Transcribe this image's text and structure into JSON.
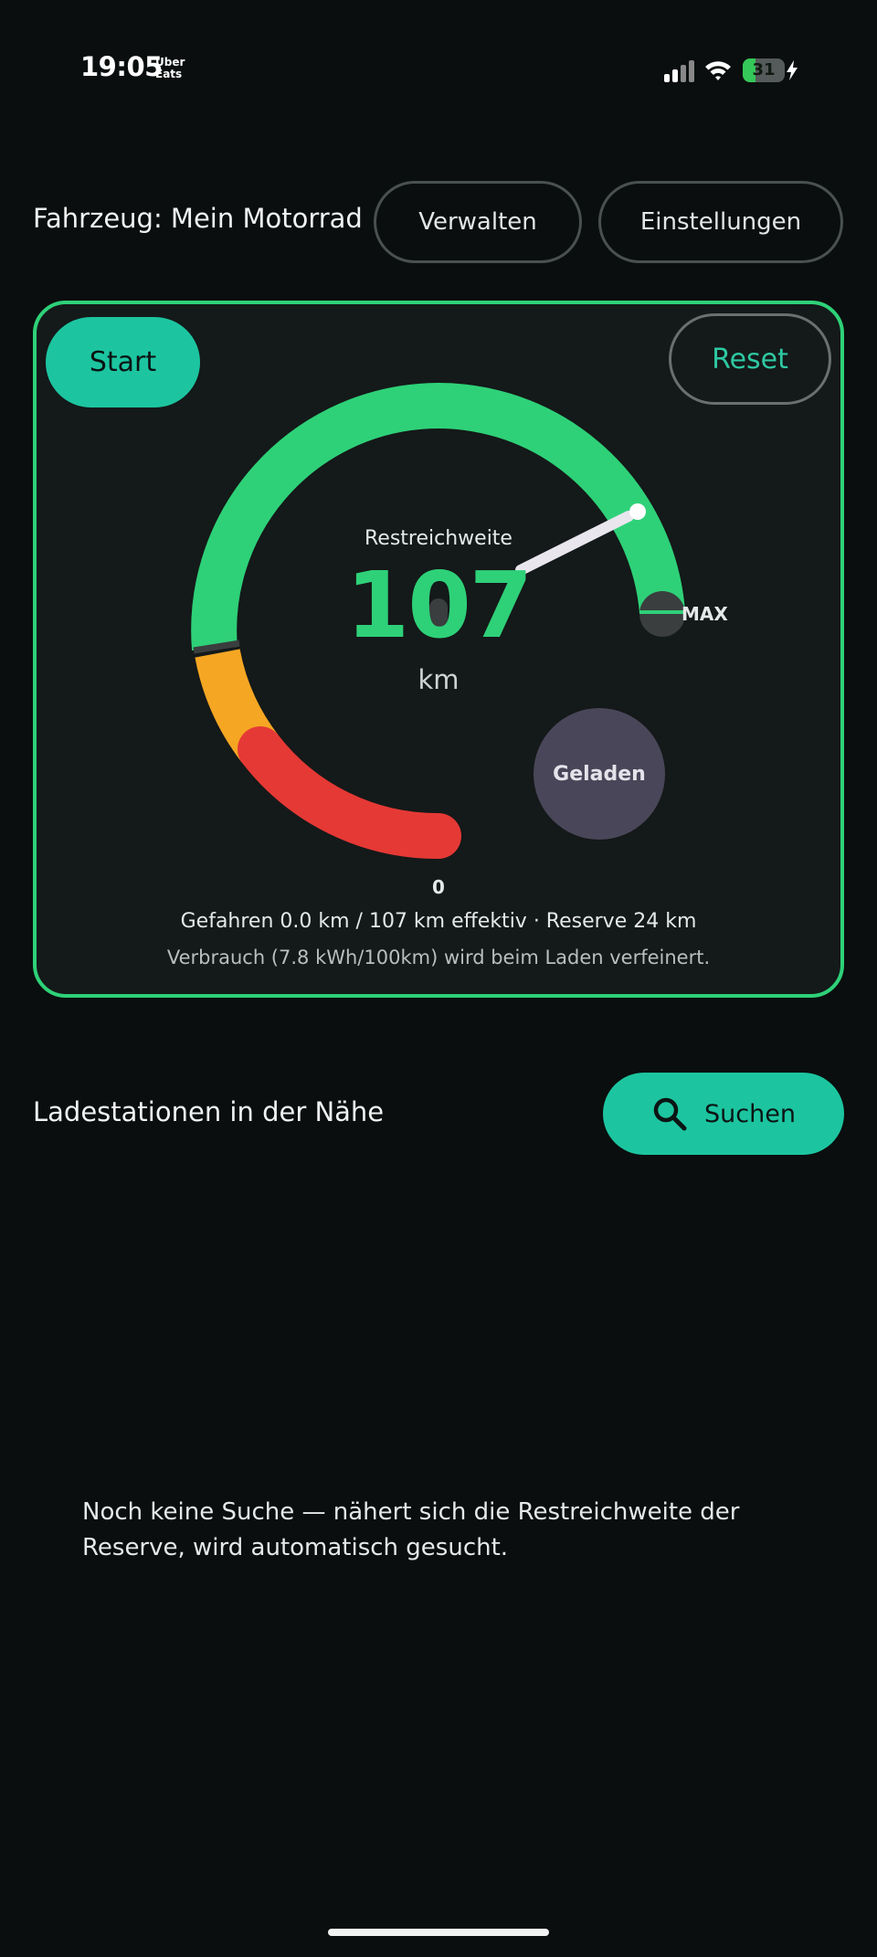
{
  "status_bar": {
    "time": "19:05",
    "app_badge": "Uber\nEats",
    "battery_level": 31,
    "battery_text": "31",
    "charging": true
  },
  "vehicle": {
    "label": "Fahrzeug: Mein Motorrad",
    "manage_label": "Verwalten",
    "settings_label": "Einstellungen"
  },
  "gauge": {
    "start_label": "Start",
    "reset_label": "Reset",
    "title": "Restreichweite",
    "value": "107",
    "unit": "km",
    "max_label": "MAX",
    "zero_label": "0",
    "charged_label": "Geladen",
    "driven_text": "Gefahren 0.0 km / 107 km effektiv · Reserve 24 km",
    "consumption_text": "Verbrauch (7.8 kWh/100km) wird beim Laden verfeinert.",
    "colors": {
      "green": "#2ed178",
      "orange": "#f5a623",
      "red": "#e53935",
      "track": "#3a3e3e",
      "needle": "#e9e6ee"
    }
  },
  "stations": {
    "title": "Ladestationen in der Nähe",
    "search_label": "Suchen",
    "search_icon": "search-icon",
    "empty_text": "Noch keine Suche — nähert sich die Restreichweite der Reserve, wird automatisch gesucht."
  },
  "accent_color": "#1cc5a0"
}
